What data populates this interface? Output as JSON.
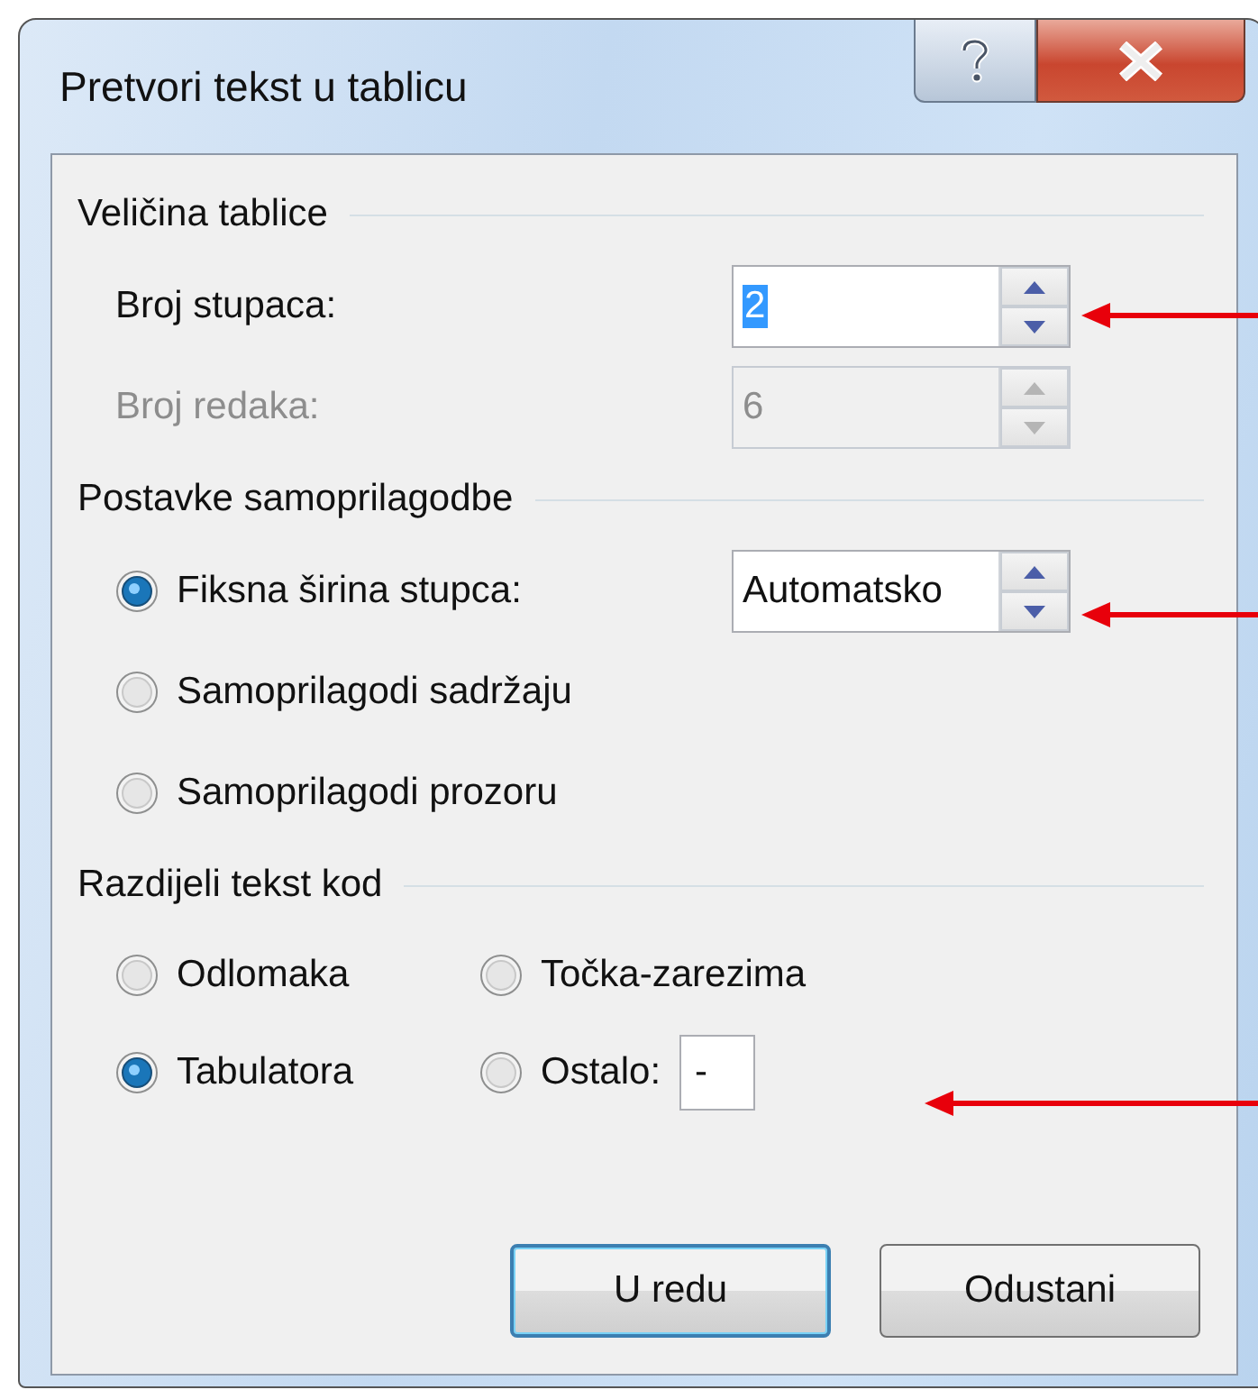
{
  "window": {
    "title": "Pretvori tekst u tablicu"
  },
  "sections": [
    {
      "title": "Veličina tablice",
      "items": [
        {
          "kind": "spinner",
          "label": "Broj stupaca:",
          "value": "2",
          "value_selected": true,
          "disabled": false
        },
        {
          "kind": "spinner",
          "label": "Broj redaka:",
          "value": "6",
          "value_selected": false,
          "disabled": true
        }
      ]
    },
    {
      "title": "Postavke samoprilagodbe",
      "items": [
        {
          "kind": "radio_spinner",
          "label": "Fiksna širina stupca:",
          "selected": true,
          "value": "Automatsko"
        },
        {
          "kind": "radio",
          "label": "Samoprilagodi sadržaju",
          "selected": false
        },
        {
          "kind": "radio",
          "label": "Samoprilagodi prozoru",
          "selected": false
        }
      ]
    },
    {
      "title": "Razdijeli tekst kod",
      "grid": [
        {
          "kind": "radio",
          "label": "Odlomaka",
          "selected": false
        },
        {
          "kind": "radio",
          "label": "Točka-zarezima",
          "selected": false
        },
        {
          "kind": "radio",
          "label": "Tabulatora",
          "selected": true
        },
        {
          "kind": "radio_field",
          "label": "Ostalo:",
          "selected": false,
          "entry": "-"
        }
      ]
    }
  ],
  "buttons": [
    {
      "label": "U redu",
      "default": true
    },
    {
      "label": "Odustani",
      "default": false
    }
  ]
}
